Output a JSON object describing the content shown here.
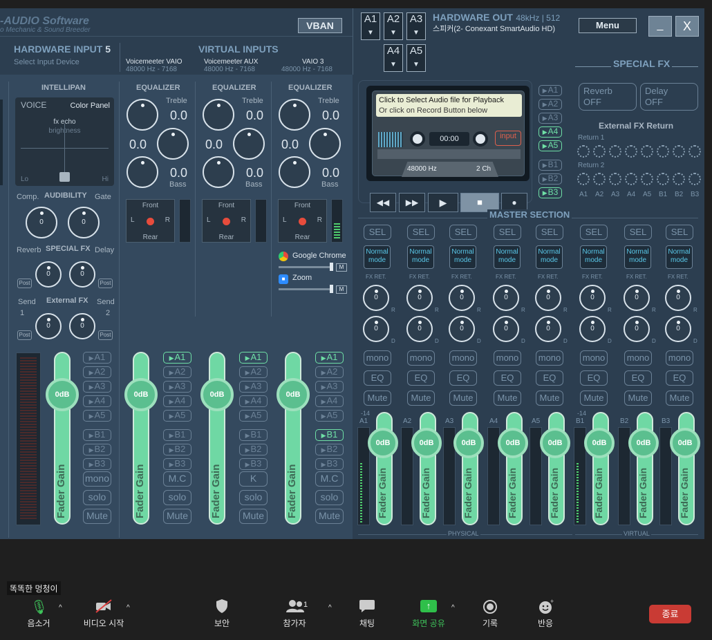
{
  "app": {
    "logo_line1": "-AUDIO Software",
    "logo_line2": "o Mechanic & Sound Breeder",
    "vban": "VBAN",
    "menu": "Menu",
    "minimize": "_",
    "close": "X"
  },
  "hardware_input": {
    "title": "HARDWARE INPUT",
    "num": "5",
    "sub": "Select Input Device"
  },
  "virtual_inputs": {
    "title": "VIRTUAL INPUTS",
    "strips": [
      {
        "name": "Voicemeeter VAIO",
        "rate": "48000 Hz - 7168"
      },
      {
        "name": "Voicemeeter AUX",
        "rate": "48000 Hz - 7168"
      },
      {
        "name": "VAIO 3",
        "rate": "48000 Hz - 7168"
      }
    ]
  },
  "hardware_out": {
    "title": "HARDWARE OUT",
    "rate": "48kHz | 512",
    "device": "스피커(2- Conexant SmartAudio HD)",
    "buttons": [
      "A1",
      "A2",
      "A3",
      "A4",
      "A5"
    ]
  },
  "intellipan": {
    "title": "INTELLIPAN",
    "voice": "VOICE",
    "color_panel": "Color Panel",
    "fx_echo": "fx echo",
    "brightness": "brightness",
    "lo": "Lo",
    "hi": "Hi"
  },
  "audibility": {
    "title": "AUDIBILITY",
    "comp": "Comp.",
    "gate": "Gate",
    "comp_val": "0",
    "gate_val": "0"
  },
  "special_fx_strip": {
    "title": "SPECIAL FX",
    "reverb": "Reverb",
    "delay": "Delay",
    "rev_val": "0",
    "del_val": "0",
    "post": "Post"
  },
  "external_fx_strip": {
    "title": "External FX",
    "send": "Send",
    "s1": "1",
    "s2": "2",
    "v1": "0",
    "v2": "0",
    "post": "Post"
  },
  "equalizer": {
    "title": "EQUALIZER",
    "treble": "Treble",
    "bass": "Bass",
    "val": "0.0"
  },
  "pan": {
    "front": "Front",
    "rear": "Rear",
    "l": "L",
    "r": "R"
  },
  "apps": [
    {
      "name": "Google Chrome",
      "m": "M"
    },
    {
      "name": "Zoom",
      "m": "M"
    }
  ],
  "fader": {
    "db": "0dB",
    "gain": "Fader Gain"
  },
  "bus_buttons": [
    "A1",
    "A2",
    "A3",
    "A4",
    "A5",
    "B1",
    "B2",
    "B3"
  ],
  "strip_buttons": {
    "hw": [
      "mono",
      "solo",
      "Mute"
    ],
    "v1": [
      "M.C",
      "solo",
      "Mute"
    ],
    "v2": [
      "K",
      "solo",
      "Mute"
    ],
    "v3": [
      "M.C",
      "solo",
      "Mute"
    ]
  },
  "special_fx_panel": {
    "title": "SPECIAL FX",
    "reverb": "Reverb",
    "reverb_state": "OFF",
    "delay": "Delay",
    "delay_state": "OFF",
    "ext_title": "External FX Return",
    "return1": "Return 1",
    "return2": "Return 2",
    "bus_labels": [
      "A1",
      "A2",
      "A3",
      "A4",
      "A5",
      "B1",
      "B2",
      "B3"
    ]
  },
  "player": {
    "msg1": "Click to Select Audio file for Playback",
    "msg2": "Or click on Record Button below",
    "time": "00:00",
    "input": "input",
    "rate": "48000 Hz",
    "channels": "2 Ch",
    "routes": [
      "A1",
      "A2",
      "A3",
      "A4",
      "A5",
      "B1",
      "B2",
      "B3"
    ]
  },
  "master": {
    "title": "MASTER SECTION",
    "sel": "SEL",
    "normal": "Normal mode",
    "fxret": "FX RET.",
    "knob": "0",
    "r": "R",
    "d": "D",
    "mono": "mono",
    "eq": "EQ",
    "mute": "Mute",
    "db": "0dB",
    "gain": "Fader Gain",
    "minus14": "-14",
    "buses": [
      "A1",
      "A2",
      "A3",
      "A4",
      "A5",
      "B1",
      "B2",
      "B3"
    ],
    "physical": "PHYSICAL",
    "virtual": "VIRTUAL"
  },
  "zoom": {
    "name_tag": "똑똑한 멍청이",
    "mute": "음소거",
    "video": "비디오 시작",
    "security": "보안",
    "participants": "참가자",
    "participants_count": "1",
    "chat": "채팅",
    "share": "화면 공유",
    "record": "기록",
    "react": "반응",
    "end": "종료"
  }
}
